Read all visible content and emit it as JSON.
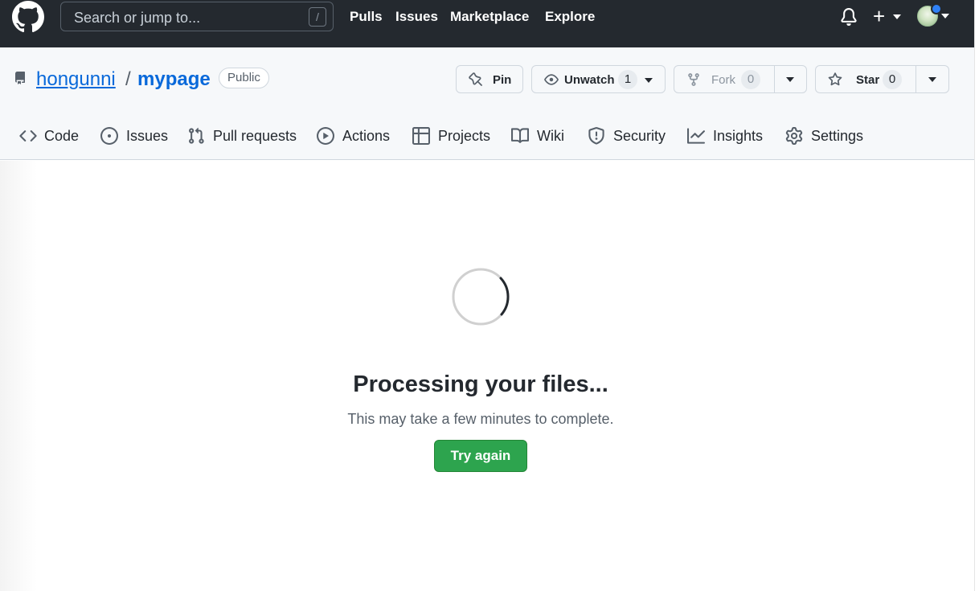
{
  "topbar": {
    "search_placeholder": "Search or jump to...",
    "search_shortcut": "/",
    "links": [
      "Pulls",
      "Issues",
      "Marketplace",
      "Explore"
    ],
    "new_label": "+"
  },
  "repo": {
    "owner": "hongunni",
    "separator": "/",
    "name": "mypage",
    "visibility": "Public",
    "pin_label": "Pin",
    "watch_label": "Unwatch",
    "watch_count": "1",
    "fork_label": "Fork",
    "fork_count": "0",
    "star_label": "Star",
    "star_count": "0"
  },
  "tabs": [
    "Code",
    "Issues",
    "Pull requests",
    "Actions",
    "Projects",
    "Wiki",
    "Security",
    "Insights",
    "Settings"
  ],
  "main": {
    "title": "Processing your files...",
    "subtitle": "This may take a few minutes to complete.",
    "button": "Try again"
  },
  "colors": {
    "header_bg": "#24292f",
    "link_blue": "#0969da",
    "primary_green": "#2da44e",
    "notification_blue": "#2f81f7"
  },
  "icons": {
    "logo": "github-mark-icon",
    "bell": "bell-icon",
    "repo": "repo-icon",
    "pin": "pin-icon",
    "eye": "eye-icon",
    "fork": "repo-forked-icon",
    "star": "star-icon"
  }
}
